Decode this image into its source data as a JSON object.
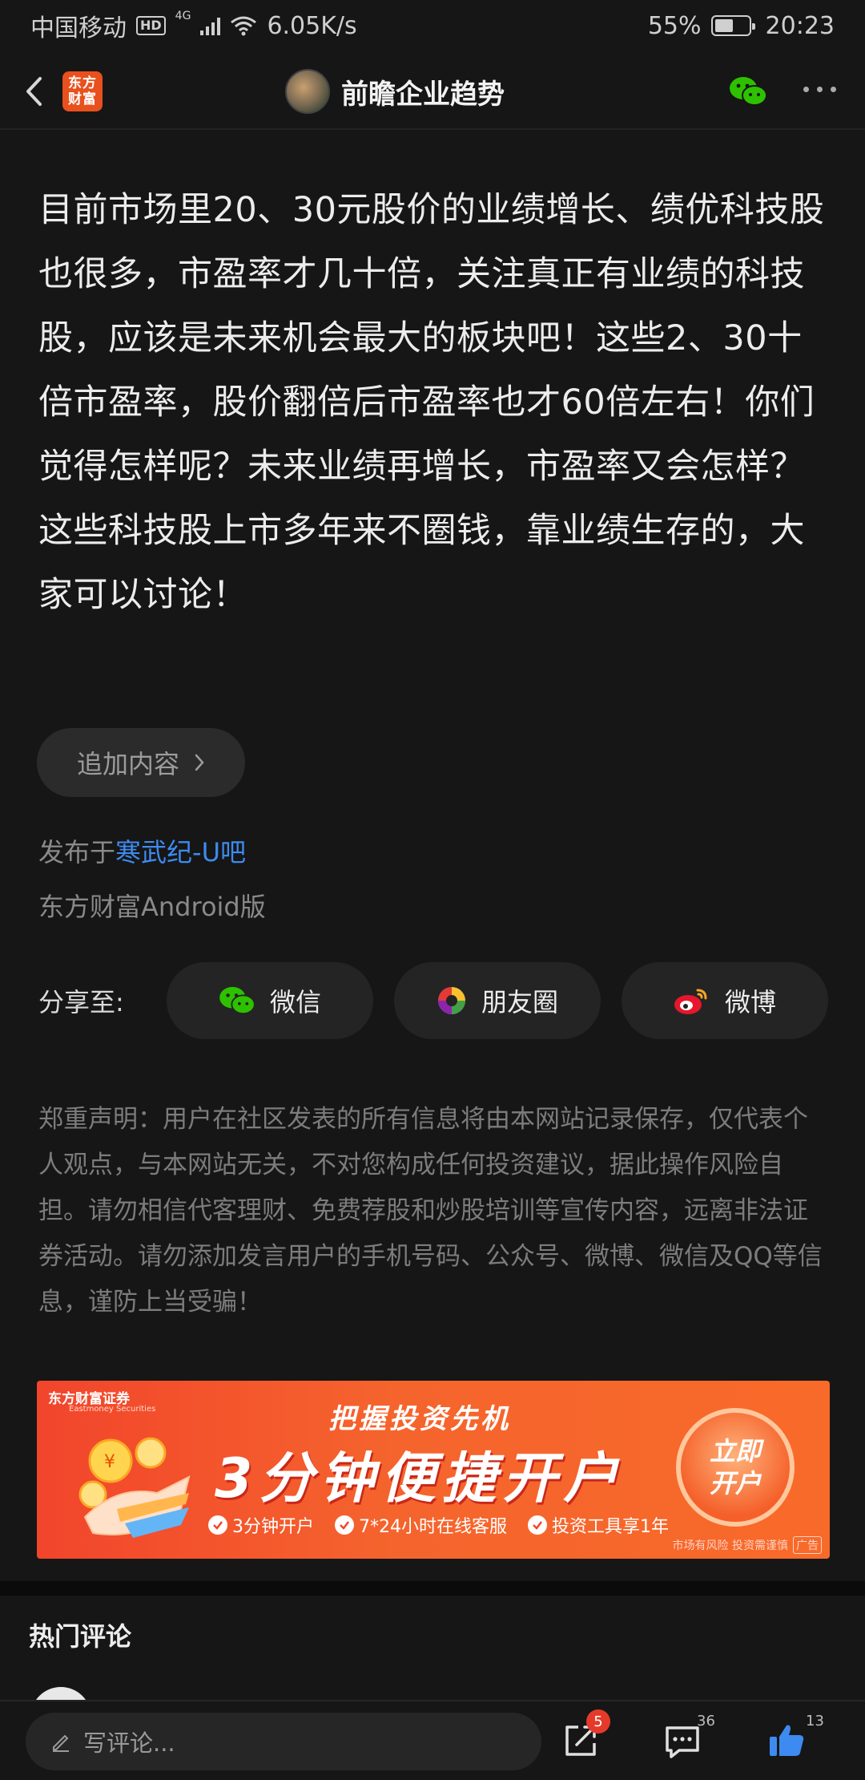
{
  "status_bar": {
    "carrier": "中国移动",
    "hd": "HD",
    "network": "4G",
    "speed": "6.05K/s",
    "battery": "55%",
    "battery_level": 0.55,
    "time": "20:23"
  },
  "nav": {
    "app_logo_line1": "东方",
    "app_logo_line2": "财富",
    "title": "前瞻企业趋势"
  },
  "article": {
    "body": "目前市场里20、30元股价的业绩增长、绩优科技股也很多，市盈率才几十倍，关注真正有业绩的科技股，应该是未来机会最大的板块吧！这些2、30十倍市盈率，股价翻倍后市盈率也才60倍左右！你们觉得怎样呢？未来业绩再增长，市盈率又会怎样？这些科技股上市多年来不圈钱，靠业绩生存的，大家可以讨论！",
    "add_content": "追加内容",
    "published_prefix": "发布于",
    "published_board": "寒武纪-U吧",
    "client": "东方财富Android版"
  },
  "share": {
    "label": "分享至:",
    "targets": [
      {
        "label": "微信",
        "icon": "wechat-icon"
      },
      {
        "label": "朋友圈",
        "icon": "moments-icon"
      },
      {
        "label": "微博",
        "icon": "weibo-icon"
      }
    ]
  },
  "disclaimer": "郑重声明：用户在社区发表的所有信息将由本网站记录保存，仅代表个人观点，与本网站无关，不对您构成任何投资建议，据此操作风险自担。请勿相信代客理财、免费荐股和炒股培训等宣传内容，远离非法证券活动。请勿添加发言用户的手机号码、公众号、微博、微信及QQ等信息，谨防上当受骗！",
  "ad": {
    "brand": "东方财富证券",
    "brand_en": "Eastmoney Securities",
    "headline": "把握投资先机",
    "main": "3分钟便捷开户",
    "features": [
      "3分钟开户",
      "7*24小时在线客服",
      "投资工具享1年"
    ],
    "cta_line1": "立即",
    "cta_line2": "开户",
    "risk": "市场有风险 投资需谨慎",
    "tag": "广告"
  },
  "comments": {
    "header": "热门评论"
  },
  "bottom_bar": {
    "placeholder": "写评论...",
    "share_badge": "5",
    "comment_count": "36",
    "like_count": "13"
  },
  "colors": {
    "background": "#161616",
    "link": "#3d8bf0",
    "accent_orange": "#e8501e",
    "wechat_green": "#2dc100",
    "badge_red": "#e53a2a"
  }
}
